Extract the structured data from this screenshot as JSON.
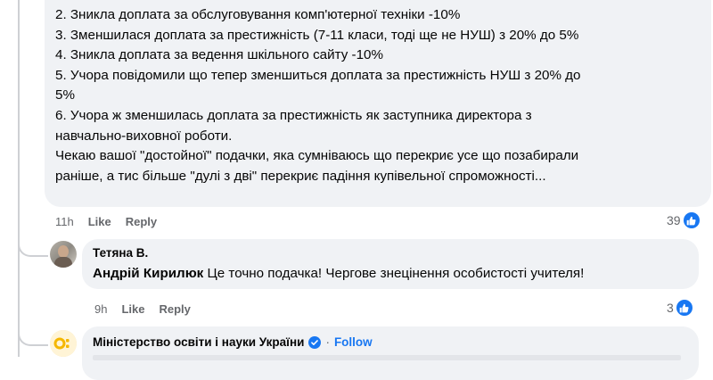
{
  "main_comment": {
    "lines": [
      "2. Зникла доплата за обслуговування комп'ютерної техніки -10%",
      "3. Зменшилася доплата за престижність (7-11 класи, тоді ще не НУШ) з 20% до 5%",
      "4. Зникла доплата за ведення шкільного сайту -10%",
      "5. Учора повідомили що тепер зменшиться доплата за престижність НУШ з 20% до",
      "5%",
      "6. Учора ж зменшилась доплата за престижність як заступника директора з",
      "навчально-виховної роботи.",
      "Чекаю вашої \"достойної\" подачки, яка сумніваюсь що перекриє усе що позабирали",
      "раніше, а тис більше \"дулі з дві\" перекриє падіння купівельної спроможності..."
    ],
    "time": "11h",
    "like_label": "Like",
    "reply_label": "Reply",
    "reaction_count": "39",
    "reaction_icon": "like-icon"
  },
  "reply_comment": {
    "author": "Тетяна В.",
    "mention": "Андрій Кирилюк",
    "text": "Це точно подачка! Чергове знецінення особистості учителя!",
    "time": "9h",
    "like_label": "Like",
    "reply_label": "Reply",
    "reaction_count": "3",
    "reaction_icon": "like-icon"
  },
  "org_comment": {
    "author": "Міністерство освіти і науки України",
    "verified_icon": "verified-badge-icon",
    "separator": "·",
    "follow_label": "Follow"
  },
  "colors": {
    "bubble": "#f0f2f5",
    "meta_text": "#65676b",
    "accent": "#1877f2"
  }
}
